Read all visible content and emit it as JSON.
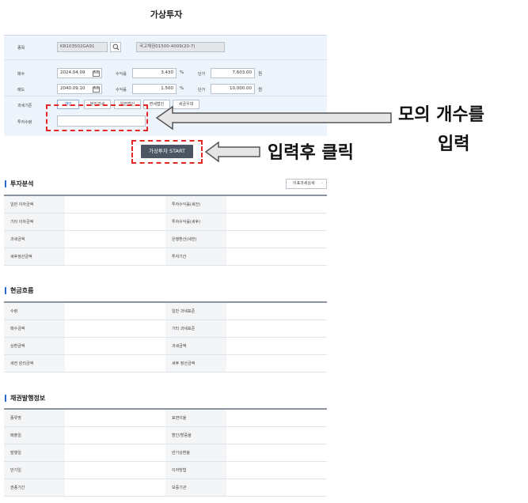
{
  "page": {
    "title": "가상투자"
  },
  "form": {
    "item_label": "종목",
    "item_code": "KR103502GA91",
    "item_name": "국고채권01500-4009(20-7)",
    "buy_label": "매수",
    "buy_date": "2024.04.09",
    "sell_label": "매도",
    "sell_date": "2040.09.10",
    "yield_label": "수익률",
    "buy_yield": "3.430",
    "sell_yield": "1.500",
    "percent_unit": "%",
    "price_label": "단가",
    "buy_price": "7,603.00",
    "sell_price": "10,000.00",
    "won_unit": "원",
    "tax_label": "과세기준",
    "tax_options": [
      "개인",
      "분리과세",
      "일반법인",
      "면세법인",
      "세금우대"
    ],
    "qty_label": "투자수량",
    "qty_value": ""
  },
  "start_button": "가상투자 START",
  "annotations": {
    "qty_line1": "모의 개수를",
    "qty_line2": "입력",
    "click": "입력후 클릭"
  },
  "analysis": {
    "title": "투자분석",
    "detail_button": "이표과세상세",
    "rows": [
      [
        "일반 이자금액",
        "",
        "투자수익률(세전)",
        ""
      ],
      [
        "기타 이자금액",
        "",
        "투자수익률(세후)",
        ""
      ],
      [
        "과세금액",
        "",
        "은행환산(세전)",
        ""
      ],
      [
        "세후정산금액",
        "",
        "투자기간",
        ""
      ]
    ]
  },
  "cashflow": {
    "title": "현금흐름",
    "rows": [
      [
        "수량",
        "",
        "일반 과세표준",
        ""
      ],
      [
        "매수금액",
        "",
        "기타 과세표준",
        ""
      ],
      [
        "상환금액",
        "",
        "과세금액",
        ""
      ],
      [
        "세전 원리금액",
        "",
        "세후 정산금액",
        ""
      ]
    ]
  },
  "bondinfo": {
    "title": "채권발행정보",
    "rows": [
      [
        "종류명",
        "",
        "표면이율",
        ""
      ],
      [
        "매출일",
        "",
        "할인/할증율",
        ""
      ],
      [
        "발행일",
        "",
        "만기상환율",
        ""
      ],
      [
        "만기일",
        "",
        "이자방법",
        ""
      ],
      [
        "권종기간",
        "",
        "보증기관",
        ""
      ]
    ]
  },
  "colors": {
    "accent": "#2d6cd2",
    "highlight": "#e32626",
    "button": "#4b5563"
  }
}
